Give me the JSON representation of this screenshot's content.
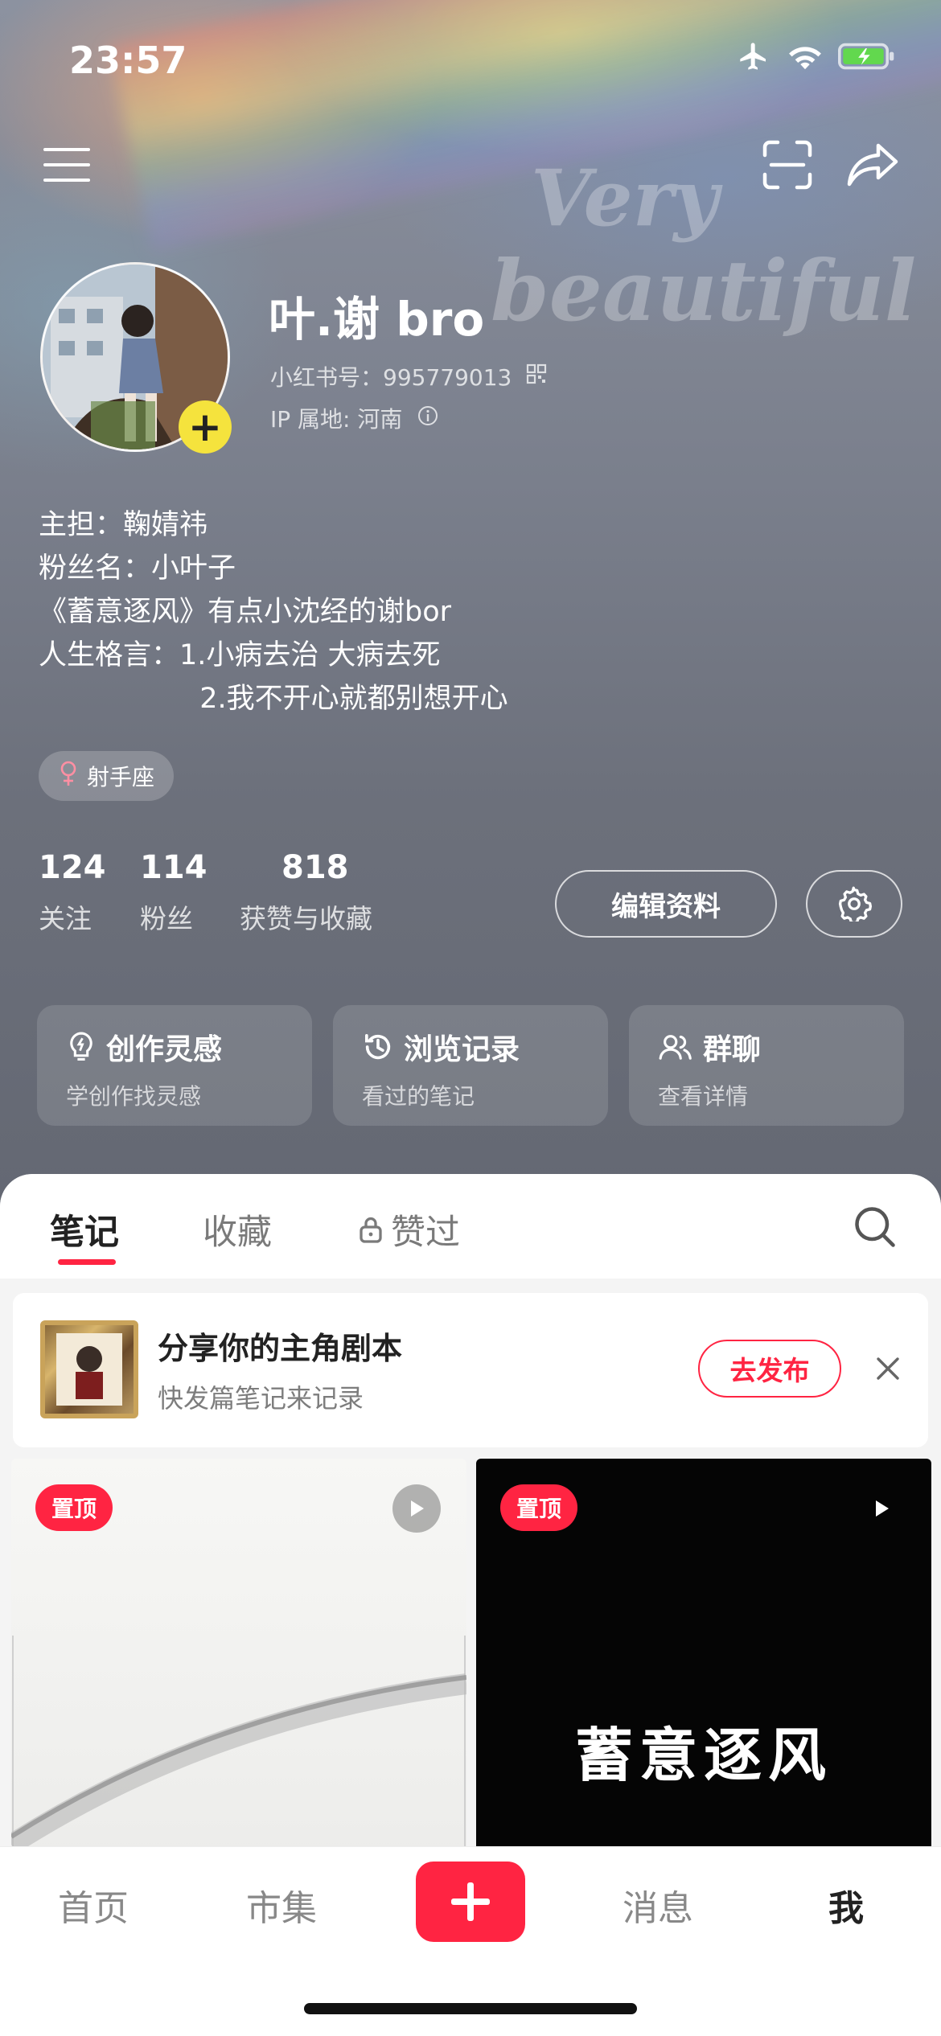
{
  "status_bar": {
    "time": "23:57"
  },
  "profile": {
    "nickname": "叶.谢 bro",
    "id_label": "小红书号：995779013",
    "ip_label": "IP 属地: 河南",
    "bio_lines": [
      "主担：鞠婧祎",
      "粉丝名：小叶子",
      "《蓄意逐风》有点小沈经的谢bor",
      "人生格言：1.小病去治 大病去死",
      "                  2.我不开心就都别想开心"
    ],
    "zodiac": "射手座",
    "watermark": [
      "Very",
      "beautiful"
    ]
  },
  "stats": [
    {
      "num": "124",
      "label": "关注"
    },
    {
      "num": "114",
      "label": "粉丝"
    },
    {
      "num": "818",
      "label": "获赞与收藏"
    }
  ],
  "actions": {
    "edit_profile": "编辑资料"
  },
  "cards": [
    {
      "title": "创作灵感",
      "sub": "学创作找灵感",
      "icon": "lightbulb-icon"
    },
    {
      "title": "浏览记录",
      "sub": "看过的笔记",
      "icon": "clock-icon"
    },
    {
      "title": "群聊",
      "sub": "查看详情",
      "icon": "group-icon"
    }
  ],
  "tabs": [
    {
      "label": "笔记",
      "active": true
    },
    {
      "label": "收藏",
      "active": false
    },
    {
      "label": "赞过",
      "active": false,
      "locked": true
    }
  ],
  "promo": {
    "title": "分享你的主角剧本",
    "sub": "快发篇笔记来记录",
    "button": "去发布"
  },
  "posts": [
    {
      "pin_label": "置顶",
      "type": "video",
      "caption": ""
    },
    {
      "pin_label": "置顶",
      "type": "video",
      "caption": "蓄意逐风"
    }
  ],
  "bottom_nav": {
    "home": "首页",
    "market": "市集",
    "messages": "消息",
    "me": "我"
  },
  "colors": {
    "accent": "#ff2442",
    "avatar_badge": "#f5e33d",
    "battery": "#62d84e"
  }
}
